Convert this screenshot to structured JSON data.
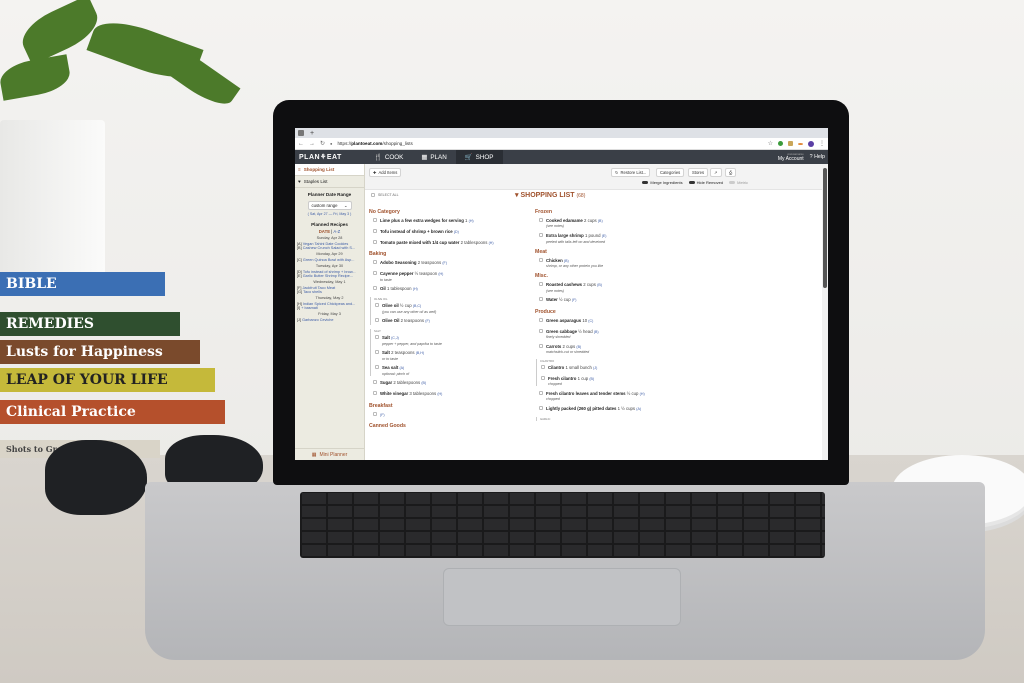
{
  "browser": {
    "new_tab_symbol": "+",
    "url_prefix": "https://",
    "url_domain": "plantoeat.com",
    "url_path": "/shopping_lists"
  },
  "app": {
    "logo": "PLAN⚘EAT",
    "nav": [
      {
        "label": "COOK",
        "icon": "fork-knife-icon"
      },
      {
        "label": "PLAN",
        "icon": "calendar-icon"
      },
      {
        "label": "SHOP",
        "icon": "cart-icon",
        "active": true
      }
    ],
    "account_sub": "yourusername",
    "account_label": "My Account",
    "help_label": "Help"
  },
  "sidebar": {
    "items": [
      {
        "label": "Shopping List",
        "icon": "list-icon",
        "active": true
      },
      {
        "label": "Staples List",
        "icon": "heart-icon"
      }
    ],
    "range_heading": "Planner Date Range",
    "range_select": "custom range",
    "range_text": "( Sat, Apr 27 — Fri, May 3 )",
    "recipes_heading": "Planned Recipes",
    "sort_date": "DATE",
    "sort_sep": "|",
    "sort_az": "A-Z",
    "days": [
      {
        "day": "Sunday, Apr 28",
        "recipes": [
          {
            "tag": "[A]",
            "name": "Vegan Tahini Date Cookies"
          },
          {
            "tag": "[B]",
            "name": "Cashew Crunch Salad with S..."
          }
        ]
      },
      {
        "day": "Monday, Apr 29",
        "recipes": [
          {
            "tag": "[C]",
            "name": "Green Quinoa Bowl with Asp..."
          }
        ]
      },
      {
        "day": "Tuesday, Apr 30",
        "recipes": [
          {
            "tag": "[D]",
            "name": "Tofu instead of shrimp + brow..."
          },
          {
            "tag": "[E]",
            "name": "Garlic Butter Shrimp Recipe..."
          }
        ]
      },
      {
        "day": "Wednesday, May 1",
        "recipes": [
          {
            "tag": "[F]",
            "name": "Jackfruit Taco Meat"
          },
          {
            "tag": "[G]",
            "name": "Taco shells"
          }
        ]
      },
      {
        "day": "Thursday, May 2",
        "recipes": [
          {
            "tag": "[H]",
            "name": "Indian Spiced Chickpeas and..."
          },
          {
            "tag": "[I]",
            "name": "+ basmati"
          }
        ]
      },
      {
        "day": "Friday, May 3",
        "recipes": [
          {
            "tag": "[J]",
            "name": "Garbanzo Ceviche"
          }
        ]
      }
    ],
    "mini_planner": "Mini Planner"
  },
  "toolbar": {
    "add_items": "Add Items",
    "restore_list": "Restore List...",
    "categories": "Categories",
    "stores": "Stores",
    "toggles": [
      {
        "label": "Merge Ingredients",
        "on": true
      },
      {
        "label": "Hide Removed",
        "on": true
      },
      {
        "label": "Metric",
        "on": false
      }
    ]
  },
  "list": {
    "select_all": "SELECT ALL",
    "title": "SHOPPING LIST",
    "count": "(68)",
    "left": [
      {
        "category": "No Category",
        "items": [
          {
            "name": "Lime plus a few extra wedges for serving",
            "qty": "1",
            "tag": "(H)"
          },
          {
            "name": "Tofu instead of shrimp + brown rice",
            "qty": "",
            "tag": "(D)"
          },
          {
            "name": "Tomato paste mixed with 1/4 cup water",
            "qty": "2 tablespoons",
            "tag": "(H)"
          }
        ]
      },
      {
        "category": "Baking",
        "items": [
          {
            "name": "Adobo Seasoning",
            "qty": "2 teaspoons",
            "tag": "(F)"
          },
          {
            "name": "Cayenne pepper",
            "qty": "½ teaspoon",
            "tag": "(H)",
            "note": "to taste"
          },
          {
            "name": "Oil",
            "qty": "1 tablespoon",
            "tag": "(H)"
          }
        ]
      },
      {
        "group": "OLIVE OIL",
        "items": [
          {
            "name": "Olive oil",
            "qty": "½ cup",
            "tag": "(B,C)",
            "note": "(you can use any other oil as well)"
          },
          {
            "name": "Olive Oil",
            "qty": "2 teaspoons",
            "tag": "(F)"
          }
        ]
      },
      {
        "group": "SALT",
        "items": [
          {
            "name": "Salt",
            "qty": "",
            "tag": "(C,J)",
            "note": "pepper + pepper, and paprika to taste"
          },
          {
            "name": "Salt",
            "qty": "2 teaspoons",
            "tag": "(B,H)",
            "note": "or to taste"
          },
          {
            "name": "Sea salt",
            "qty": "",
            "tag": "(A)",
            "note": "optional: pinch of"
          }
        ]
      },
      {
        "category": "",
        "items": [
          {
            "name": "Sugar",
            "qty": "2 tablespoons",
            "tag": "(B)"
          },
          {
            "name": "White vinegar",
            "qty": "3 tablespoons",
            "tag": "(H)"
          }
        ]
      },
      {
        "category": "Breakfast",
        "items": [
          {
            "name": "",
            "qty": "",
            "tag": "(F)"
          }
        ]
      },
      {
        "category": "Canned Goods",
        "items": []
      }
    ],
    "right": [
      {
        "category": "Frozen",
        "items": [
          {
            "name": "Cooked edamame",
            "qty": "2 cups",
            "tag": "(B)",
            "note": "(see notes)"
          },
          {
            "name": "Extra large shrimp",
            "qty": "1 pound",
            "tag": "(E)",
            "note": "peeled with tails left on and deveined"
          }
        ]
      },
      {
        "category": "Meat",
        "items": [
          {
            "name": "Chicken",
            "qty": "",
            "tag": "(B)",
            "note": "shrimp, or any other protein you like"
          }
        ]
      },
      {
        "category": "Misc.",
        "items": [
          {
            "name": "Roasted cashews",
            "qty": "2 cups",
            "tag": "(B)",
            "note": "(see notes)"
          },
          {
            "name": "Water",
            "qty": "½ cup",
            "tag": "(F)"
          }
        ]
      },
      {
        "category": "Produce",
        "items": [
          {
            "name": "Green asparagus",
            "qty": "10",
            "tag": "(C)"
          },
          {
            "name": "Green cabbage",
            "qty": "½ head",
            "tag": "(B)",
            "note": "finely shredded"
          },
          {
            "name": "Carrots",
            "qty": "2 cups",
            "tag": "(B)",
            "note": "matchstick-cut or shredded"
          }
        ]
      },
      {
        "group": "CILANTRO",
        "items": [
          {
            "name": "Cilantro",
            "qty": "1 small bunch",
            "tag": "(J)"
          },
          {
            "name": "Fresh cilantro",
            "qty": "1 cup",
            "tag": "(B)",
            "note": "chopped"
          }
        ]
      },
      {
        "category": "",
        "items": [
          {
            "name": "Fresh cilantro leaves and tender stems",
            "qty": "½ cup",
            "tag": "(H)",
            "note": "chopped"
          },
          {
            "name": "Lightly packed (260 g) pitted dates",
            "qty": "1 ½ cups",
            "tag": "(A)"
          }
        ]
      },
      {
        "group": "GARLIC",
        "items": []
      }
    ]
  },
  "scene": {
    "books": [
      "BIBLE",
      "REMEDIES",
      "Lusts for Happiness",
      "LEAP OF YOUR LIFE",
      "Clinical Practice",
      "Shots to Great Shots"
    ]
  }
}
